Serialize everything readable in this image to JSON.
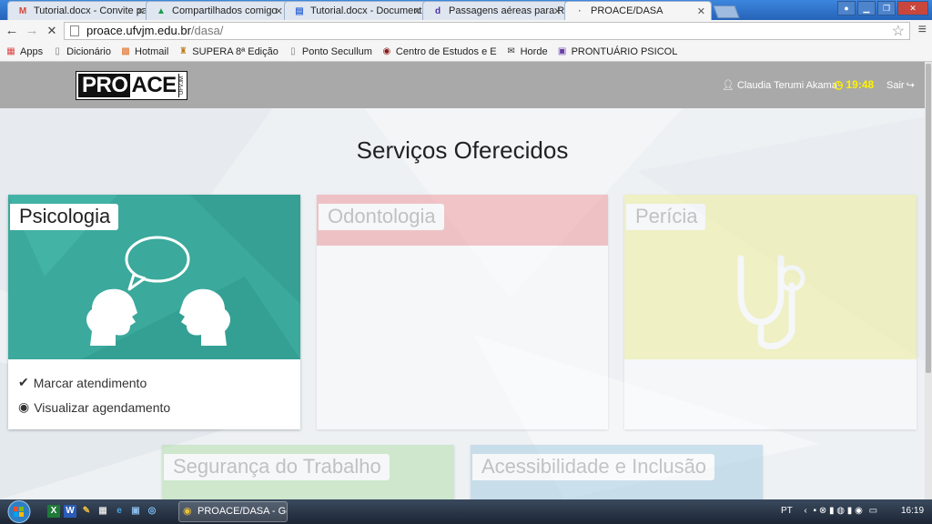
{
  "browser": {
    "tabs": [
      {
        "title": "Tutorial.docx - Convite pa",
        "icon": "gmail-icon"
      },
      {
        "title": "Compartilhados comigo",
        "icon": "drive-icon"
      },
      {
        "title": "Tutorial.docx - Document",
        "icon": "docs-icon"
      },
      {
        "title": "Passagens aéreas para Rio",
        "icon": "decolar-icon"
      },
      {
        "title": "PROACE/DASA",
        "icon": "loading-icon"
      }
    ],
    "url_host": "proace.ufvjm.edu.br",
    "url_path": "/dasa/",
    "bookmarks": [
      {
        "label": "Apps",
        "icon": "apps-icon"
      },
      {
        "label": "Dicionário",
        "icon": "page-icon"
      },
      {
        "label": "Hotmail",
        "icon": "windows-icon"
      },
      {
        "label": "SUPERA 8ª Edição",
        "icon": "supera-icon"
      },
      {
        "label": "Ponto Secullum",
        "icon": "page-icon"
      },
      {
        "label": "Centro de Estudos e E",
        "icon": "shield-icon"
      },
      {
        "label": "Horde",
        "icon": "mail-icon"
      },
      {
        "label": "PRONTUÁRIO PSICOL",
        "icon": "form-icon"
      }
    ]
  },
  "header": {
    "logo_pro": "PRO",
    "logo_ace": "ACE",
    "logo_sub": "UFVJM",
    "user_name": "Claudia Terumi Akama",
    "clock": "19:48",
    "logout": "Sair"
  },
  "main": {
    "title": "Serviços Oferecidos",
    "services": [
      {
        "label": "Psicologia",
        "color": "#3ba99c",
        "actions": [
          "Marcar atendimento",
          "Visualizar agendamento"
        ]
      },
      {
        "label": "Odontologia",
        "color": "#f08a8e"
      },
      {
        "label": "Perícia",
        "color": "#f2f08a"
      },
      {
        "label": "Segurança do Trabalho",
        "color": "#a9dba0"
      },
      {
        "label": "Acessibilidade e Inclusão",
        "color": "#9bc6e0"
      }
    ]
  },
  "taskbar": {
    "task_label": "PROACE/DASA - Go...",
    "lang": "PT",
    "time": "16:19"
  }
}
